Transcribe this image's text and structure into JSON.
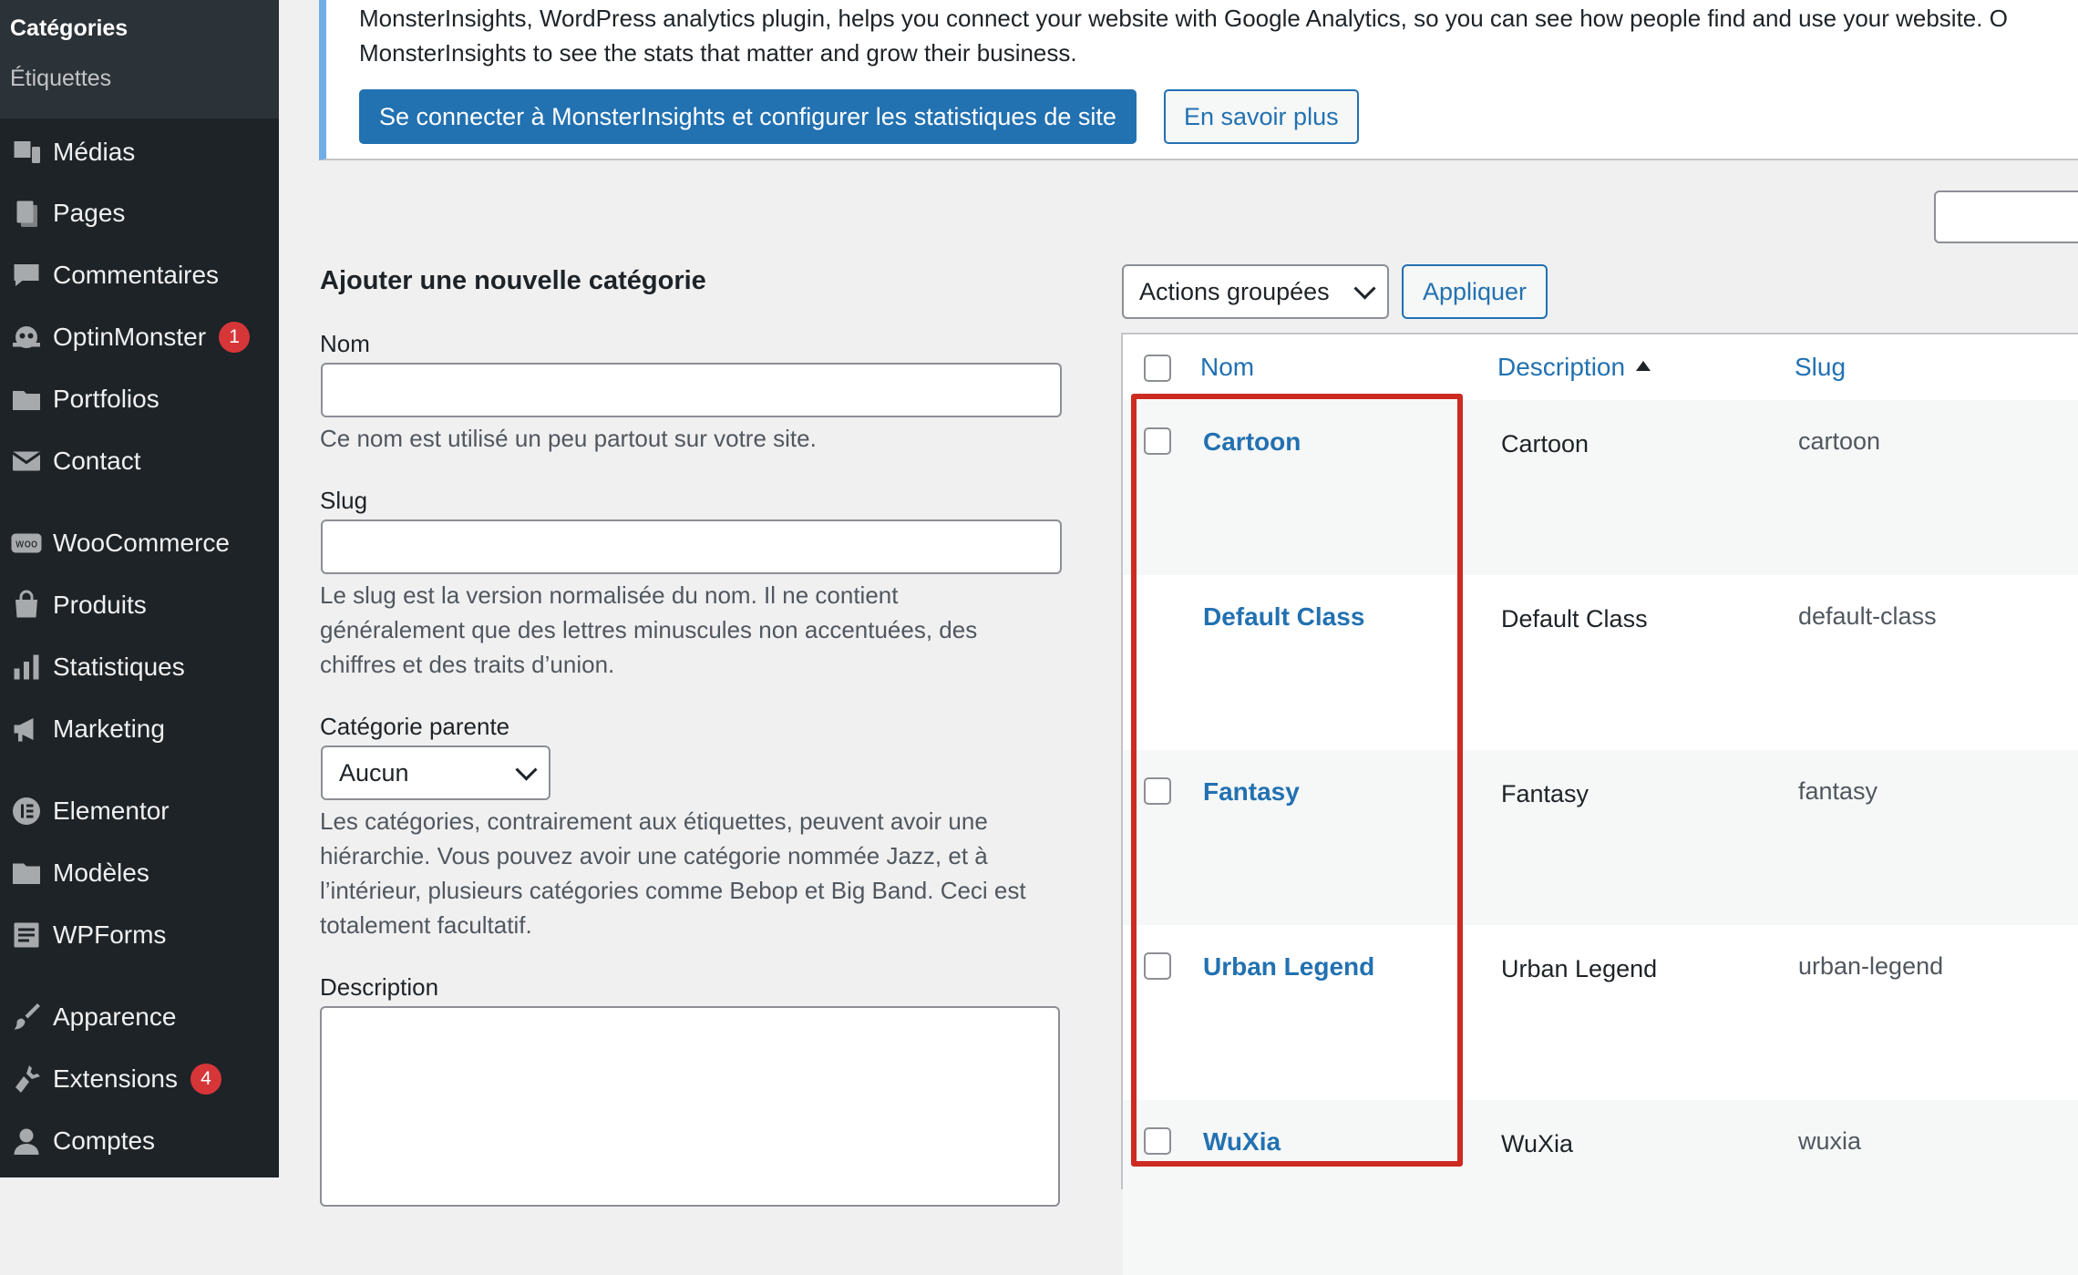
{
  "sidebar": {
    "submenu": {
      "current": "Catégories",
      "other": "Étiquettes"
    },
    "items": [
      {
        "label": "Médias",
        "icon": "media-icon"
      },
      {
        "label": "Pages",
        "icon": "pages-icon"
      },
      {
        "label": "Commentaires",
        "icon": "comments-icon"
      },
      {
        "label": "OptinMonster",
        "icon": "optinmonster-icon",
        "badge": "1"
      },
      {
        "label": "Portfolios",
        "icon": "portfolio-icon"
      },
      {
        "label": "Contact",
        "icon": "mail-icon"
      },
      {
        "label": "WooCommerce",
        "icon": "woocommerce-icon"
      },
      {
        "label": "Produits",
        "icon": "products-icon"
      },
      {
        "label": "Statistiques",
        "icon": "stats-icon"
      },
      {
        "label": "Marketing",
        "icon": "megaphone-icon"
      },
      {
        "label": "Elementor",
        "icon": "elementor-icon"
      },
      {
        "label": "Modèles",
        "icon": "folder-icon"
      },
      {
        "label": "WPForms",
        "icon": "wpforms-icon"
      },
      {
        "label": "Apparence",
        "icon": "brush-icon"
      },
      {
        "label": "Extensions",
        "icon": "plugins-icon",
        "badge": "4"
      },
      {
        "label": "Comptes",
        "icon": "user-icon"
      }
    ]
  },
  "notice": {
    "line1": "MonsterInsights, WordPress analytics plugin, helps you connect your website with Google Analytics, so you can see how people find and use your website. O",
    "line2": "MonsterInsights to see the stats that matter and grow their business.",
    "primary_button": "Se connecter à MonsterInsights et configurer les statistiques de site",
    "secondary_button": "En savoir plus"
  },
  "form": {
    "title": "Ajouter une nouvelle catégorie",
    "name_label": "Nom",
    "name_value": "",
    "name_help": "Ce nom est utilisé un peu partout sur votre site.",
    "slug_label": "Slug",
    "slug_value": "",
    "slug_help": "Le slug est la version normalisée du nom. Il ne contient généralement que des lettres minuscules non accentuées, des chiffres et des traits d’union.",
    "parent_label": "Catégorie parente",
    "parent_value": "Aucun",
    "parent_help": "Les catégories, contrairement aux étiquettes, peuvent avoir une hiérarchie. Vous pouvez avoir une catégorie nommée Jazz, et à l’intérieur, plusieurs catégories comme Bebop et Big Band. Ceci est totalement facultatif.",
    "description_label": "Description",
    "description_value": ""
  },
  "list": {
    "bulk_actions": "Actions groupées",
    "apply_button": "Appliquer",
    "columns": {
      "name": "Nom",
      "description": "Description",
      "slug": "Slug"
    },
    "rows": [
      {
        "name": "Cartoon",
        "description": "Cartoon",
        "slug": "cartoon",
        "checkbox": true
      },
      {
        "name": "Default Class",
        "description": "Default Class",
        "slug": "default-class",
        "checkbox": false
      },
      {
        "name": "Fantasy",
        "description": "Fantasy",
        "slug": "fantasy",
        "checkbox": true
      },
      {
        "name": "Urban Legend",
        "description": "Urban Legend",
        "slug": "urban-legend",
        "checkbox": true
      },
      {
        "name": "WuXia",
        "description": "WuXia",
        "slug": "wuxia",
        "checkbox": true
      }
    ]
  },
  "colors": {
    "sidebar_bg": "#1d2327",
    "accent": "#2271b1",
    "badge": "#d63638",
    "highlight": "#cc2b22"
  }
}
